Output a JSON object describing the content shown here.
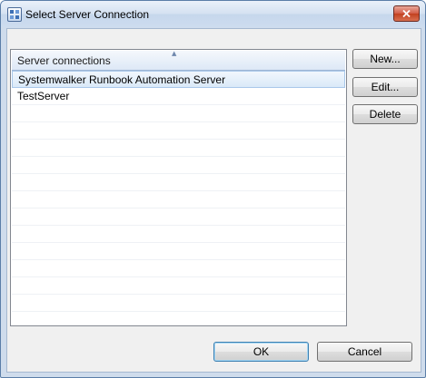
{
  "window": {
    "title": "Select Server Connection"
  },
  "list": {
    "header": "Server connections",
    "items": [
      {
        "label": "Systemwalker Runbook Automation Server",
        "selected": true
      },
      {
        "label": "TestServer",
        "selected": false
      }
    ],
    "empty_row_count": 14
  },
  "side_buttons": {
    "new_label": "New...",
    "edit_label": "Edit...",
    "delete_label": "Delete"
  },
  "footer": {
    "ok_label": "OK",
    "cancel_label": "Cancel"
  },
  "colors": {
    "title_bar": "#d4e1f1",
    "selection": "#dae9f8",
    "close_button": "#c2401f",
    "default_button_border": "#3c7fb1"
  },
  "icons": {
    "app": "app-window-icon",
    "close": "close-icon",
    "sort": "sort-ascending-icon"
  }
}
